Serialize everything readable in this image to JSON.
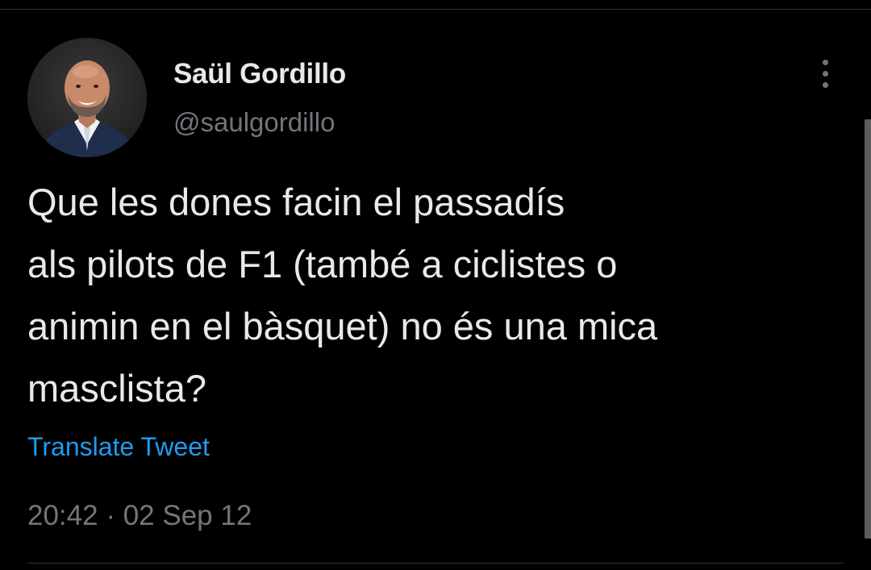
{
  "tweet": {
    "author": {
      "display_name": "Saül Gordillo",
      "handle": "@saulgordillo",
      "avatar_icon": "profile-photo"
    },
    "text_lines": [
      "Que les dones facin el passadís",
      "als pilots de F1 (també a ciclistes o",
      "animin en el bàsquet) no és una mica",
      "masclista?"
    ],
    "translate_label": "Translate Tweet",
    "time": "20:42",
    "separator": "·",
    "date": "02 Sep 12",
    "more_icon": "more-vertical-icon"
  },
  "colors": {
    "background": "#000000",
    "text_primary": "#e7e9ea",
    "text_secondary": "#71767b",
    "link": "#1d9bf0",
    "divider": "#2f3336"
  }
}
